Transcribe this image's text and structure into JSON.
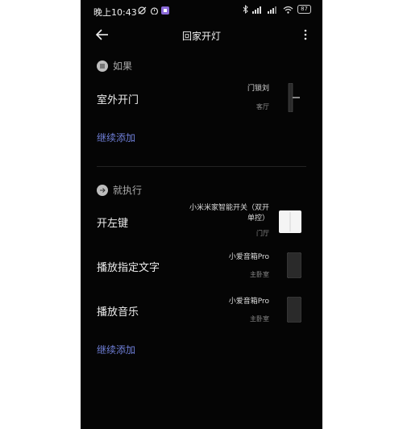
{
  "status_bar": {
    "time": "晚上10:43",
    "battery": "87"
  },
  "header": {
    "title": "回家开灯"
  },
  "if_section": {
    "heading": "如果",
    "rows": [
      {
        "label": "室外开门",
        "device": "门锁刘",
        "room": "客厅"
      }
    ],
    "add_label": "继续添加"
  },
  "then_section": {
    "heading": "就执行",
    "rows": [
      {
        "label": "开左键",
        "device": "小米米家智能开关（双开单控）",
        "room": "门厅"
      },
      {
        "label": "播放指定文字",
        "device": "小爱音箱Pro",
        "room": "主卧室"
      },
      {
        "label": "播放音乐",
        "device": "小爱音箱Pro",
        "room": "主卧室"
      }
    ],
    "add_label": "继续添加"
  },
  "colors": {
    "background": "#050505",
    "accent_link": "#6f7fd8"
  }
}
